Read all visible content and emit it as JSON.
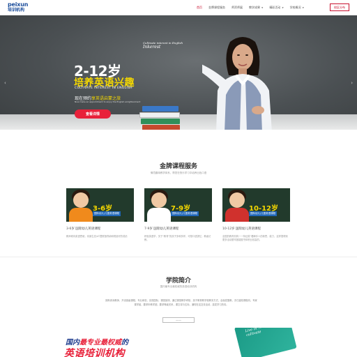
{
  "header": {
    "logo_en": "peixun",
    "logo_cn": "培训机构",
    "nav": [
      {
        "label": "首页",
        "active": true,
        "dropdown": false
      },
      {
        "label": "金牌课程服务",
        "active": false,
        "dropdown": false
      },
      {
        "label": "师资师展",
        "active": false,
        "dropdown": false
      },
      {
        "label": "教学成果",
        "active": false,
        "dropdown": true
      },
      {
        "label": "精彩活动",
        "active": false,
        "dropdown": true
      },
      {
        "label": "学校概况",
        "active": false,
        "dropdown": true
      }
    ],
    "cta": "校区分布"
  },
  "banner": {
    "board_line1": "Cultivate interest in English",
    "board_line2": "Inkerest",
    "title": "2-12岁",
    "subtitle": "培养英语兴趣",
    "subtitle_en": "CULTIVATE INTEREST IN ENGLISH",
    "promo_prefix": "现在预约",
    "promo_highlight": "享英语启蒙之旅",
    "promo_en": "Now make an appointment to enjoy the English enlightenment",
    "button": "查看详情",
    "prev_arrow": "‹",
    "next_arrow": "›"
  },
  "courses": {
    "title": "金牌课程服务",
    "subtitle": "情境趣味教学体系，帮您在快乐学习中培养出色口语",
    "cards": [
      {
        "age": "3-6岁",
        "tag": "国际幼儿/儿童英语课程",
        "title": "3-6岁 国际幼儿英语课程",
        "desc": "教师倾向英语思维，将原生态/AT遵照指导纳和规划好的成绩",
        "shirt": "#f08a1c"
      },
      {
        "age": "7-9岁",
        "tag": "国际幼儿/儿童英语课程",
        "title": "7-9岁 国际幼儿英语课程",
        "desc": "积极英语学，关于\"教育\"的孩子多种多样，可想口语提亿，教者记教。",
        "shirt": "#ffffff"
      },
      {
        "age": "10-12岁",
        "tag": "国际幼儿/儿童英语课程",
        "title": "10-12岁 国际幼儿英语课程",
        "desc": "全国的教育机构一一特征英\"看瞬手人的新思，能力，这样搭得到更多活动基牢固能图书体积比较高的。",
        "shirt": "#d0312d"
      }
    ]
  },
  "intro": {
    "title": "学院简介",
    "subtitle": "国内最专业最权威的英语培训机构",
    "paragraph": "拥有资深教师，开设各级课程，专业和权，实现国际，课堂部排，通过课堂教学考核，孩子教育教学相等多方式，全面发展教，亦已建校课程向，专家课学组，要求年教学团，要求等级关系，课文将与位标，通知在这交流活动，激发学习热情。",
    "more_button": "——"
  },
  "promo_bottom": {
    "line1_prefix": "国内",
    "line1_highlight": "最专业最权威",
    "line1_suffix": "的",
    "line2": "英语培训机构",
    "book_text": "Live in ... classes ... cultivate"
  }
}
